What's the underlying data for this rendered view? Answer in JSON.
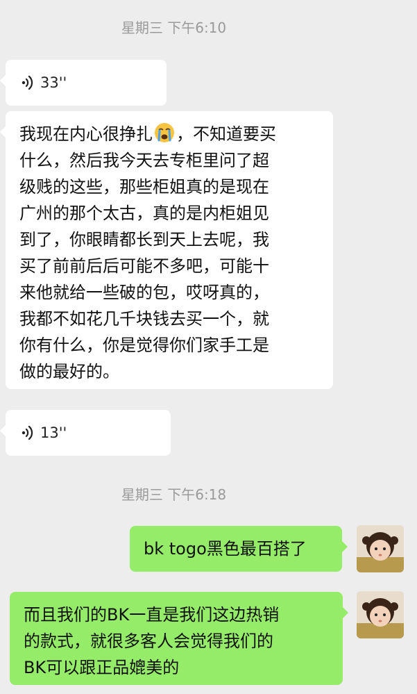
{
  "timestamps": [
    "星期三 下午6:10",
    "星期三 下午6:18"
  ],
  "messages": {
    "voice1": {
      "duration": "33''"
    },
    "text1": {
      "lines": [
        "我现在内心很挣扎",
        "，不知道要买",
        "什么，然后我今天去专柜里问了超",
        "级贱的这些，那些柜姐真的是现在",
        "广州的那个太古，真的是内柜姐见",
        "到了，你眼睛都长到天上去呢，我",
        "买了前前后后可能不多吧，可能十",
        "来他就给一些破的包，哎呀真的，",
        "我都不如花几千块钱去买一个，就",
        "你有什么，你是觉得你们家手工是",
        "做的最好的。"
      ],
      "emoji": "crying-face-emoji"
    },
    "voice2": {
      "duration": "13''"
    },
    "out1": {
      "text": "bk togo黑色最百搭了"
    },
    "out2": {
      "lines": [
        "而且我们的BK一直是我们这边热销",
        "的款式，就很多客人会觉得我们的",
        "BK可以跟正品媲美的"
      ]
    }
  },
  "colors": {
    "background": "#ededed",
    "incoming_bubble": "#ffffff",
    "outgoing_bubble": "#95ec69",
    "timestamp_text": "#9a9a9a"
  }
}
